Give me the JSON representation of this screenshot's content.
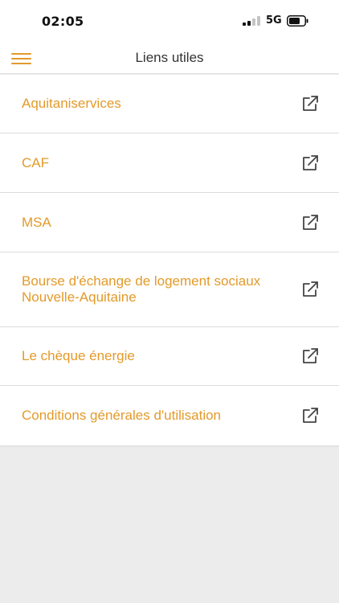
{
  "status_bar": {
    "time": "02:05",
    "network": "5G"
  },
  "header": {
    "title": "Liens utiles",
    "menu_icon": "hamburger-menu-icon"
  },
  "links": [
    {
      "label": "Aquitaniservices",
      "icon": "external-link-icon"
    },
    {
      "label": "CAF",
      "icon": "external-link-icon"
    },
    {
      "label": "MSA",
      "icon": "external-link-icon"
    },
    {
      "label": "Bourse d'échange de logement sociaux Nouvelle-Aquitaine",
      "icon": "external-link-icon"
    },
    {
      "label": "Le chèque énergie",
      "icon": "external-link-icon"
    },
    {
      "label": "Conditions générales d'utilisation",
      "icon": "external-link-icon"
    }
  ],
  "colors": {
    "accent": "#e39a2a",
    "background": "#ececec",
    "surface": "#ffffff",
    "divider": "#dcdcdc"
  }
}
